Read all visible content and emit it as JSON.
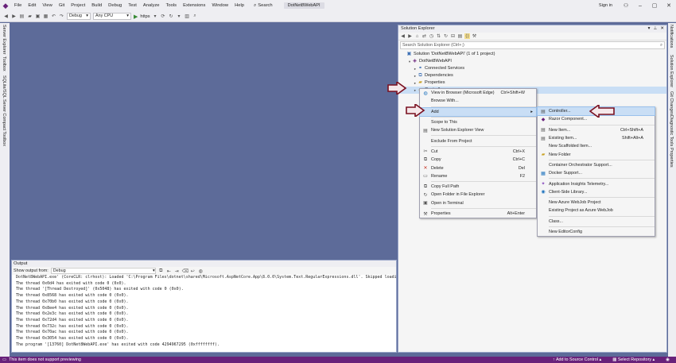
{
  "menubar": {
    "items": [
      "File",
      "Edit",
      "View",
      "Git",
      "Project",
      "Build",
      "Debug",
      "Test",
      "Analyze",
      "Tools",
      "Extensions",
      "Window",
      "Help"
    ],
    "search_label": "Search",
    "title_badge": "DotNet8WebAPI",
    "signin": "Sign in"
  },
  "toolbar": {
    "config": "Debug",
    "platform": "Any CPU",
    "run_label": "https"
  },
  "left_tabs": [
    "Server Explorer",
    "Toolbox",
    "SQLite/SQL Server Compact Toolbox"
  ],
  "right_tabs": [
    "Notifications",
    "Solution Explorer",
    "Git Changes",
    "Diagnostic Tools",
    "Properties"
  ],
  "solution_explorer": {
    "title": "Solution Explorer",
    "search_placeholder": "Search Solution Explorer (Ctrl+;)",
    "tree": [
      {
        "label": "Solution 'DotNet8WebAPI' (1 of 1 project)",
        "indent": 0,
        "icon": "solution-icon",
        "glyph": "▣"
      },
      {
        "label": "DotNet8WebAPI",
        "indent": 1,
        "icon": "project-icon",
        "glyph": "◈",
        "caret": "▾"
      },
      {
        "label": "Connected Services",
        "indent": 2,
        "icon": "connected-services-icon",
        "glyph": "⚭",
        "caret": "▸"
      },
      {
        "label": "Dependencies",
        "indent": 2,
        "icon": "dependencies-icon",
        "glyph": "⧉",
        "caret": "▸"
      },
      {
        "label": "Properties",
        "indent": 2,
        "icon": "properties-folder-icon",
        "glyph": "▰",
        "caret": "▸"
      },
      {
        "label": "Controllers",
        "indent": 2,
        "icon": "folder-icon",
        "glyph": "▰",
        "caret": "▸",
        "selected": true
      }
    ]
  },
  "context_menu": {
    "items": [
      {
        "label": "View in Browser (Microsoft Edge)",
        "shortcut": "Ctrl+Shift+W",
        "icon": "browser-icon",
        "glyph": "◍"
      },
      {
        "label": "Browse With...",
        "shortcut": "",
        "icon": "",
        "glyph": ""
      },
      {
        "sep": true
      },
      {
        "label": "Add",
        "shortcut": "",
        "submenu": true,
        "highlight": true,
        "icon": "",
        "glyph": ""
      },
      {
        "sep": true
      },
      {
        "label": "Scope to This",
        "shortcut": "",
        "icon": "",
        "glyph": ""
      },
      {
        "label": "New Solution Explorer View",
        "shortcut": "",
        "icon": "new-view-icon",
        "glyph": "▤"
      },
      {
        "sep": true
      },
      {
        "label": "Exclude From Project",
        "shortcut": "",
        "icon": "",
        "glyph": ""
      },
      {
        "sep": true
      },
      {
        "label": "Cut",
        "shortcut": "Ctrl+X",
        "icon": "cut-icon",
        "glyph": "✂"
      },
      {
        "label": "Copy",
        "shortcut": "Ctrl+C",
        "icon": "copy-icon",
        "glyph": "⧉"
      },
      {
        "label": "Delete",
        "shortcut": "Del",
        "icon": "delete-icon",
        "glyph": "✕"
      },
      {
        "label": "Rename",
        "shortcut": "F2",
        "icon": "rename-icon",
        "glyph": "▭"
      },
      {
        "sep": true
      },
      {
        "label": "Copy Full Path",
        "shortcut": "",
        "icon": "copy-path-icon",
        "glyph": "⧉"
      },
      {
        "label": "Open Folder in File Explorer",
        "shortcut": "",
        "icon": "open-folder-icon",
        "glyph": "↻"
      },
      {
        "label": "Open in Terminal",
        "shortcut": "",
        "icon": "terminal-icon",
        "glyph": "▣"
      },
      {
        "sep": true
      },
      {
        "label": "Properties",
        "shortcut": "Alt+Enter",
        "icon": "wrench-icon",
        "glyph": "⚒"
      }
    ]
  },
  "add_submenu": {
    "items": [
      {
        "label": "Controller...",
        "shortcut": "",
        "icon": "controller-icon",
        "glyph": "▤",
        "highlight": true
      },
      {
        "label": "Razor Component...",
        "shortcut": "",
        "icon": "razor-icon",
        "glyph": "◆"
      },
      {
        "sep": true
      },
      {
        "label": "New Item...",
        "shortcut": "Ctrl+Shift+A",
        "icon": "new-item-icon",
        "glyph": "▤"
      },
      {
        "label": "Existing Item...",
        "shortcut": "Shift+Alt+A",
        "icon": "existing-item-icon",
        "glyph": "▤"
      },
      {
        "label": "New Scaffolded Item...",
        "shortcut": "",
        "icon": "",
        "glyph": ""
      },
      {
        "label": "New Folder",
        "shortcut": "",
        "icon": "new-folder-icon",
        "glyph": "▰"
      },
      {
        "sep": true
      },
      {
        "label": "Container Orchestrator Support...",
        "shortcut": "",
        "icon": "",
        "glyph": ""
      },
      {
        "label": "Docker Support...",
        "shortcut": "",
        "icon": "docker-icon",
        "glyph": "▦"
      },
      {
        "sep": true
      },
      {
        "label": "Application Insights Telemetry...",
        "shortcut": "",
        "icon": "insights-icon",
        "glyph": "✦"
      },
      {
        "label": "Client-Side Library...",
        "shortcut": "",
        "icon": "library-icon",
        "glyph": "◉"
      },
      {
        "sep": true
      },
      {
        "label": "New Azure WebJob Project",
        "shortcut": "",
        "icon": "",
        "glyph": ""
      },
      {
        "label": "Existing Project as Azure WebJob",
        "shortcut": "",
        "icon": "",
        "glyph": ""
      },
      {
        "sep": true
      },
      {
        "label": "Class...",
        "shortcut": "",
        "icon": "",
        "glyph": ""
      },
      {
        "sep": true
      },
      {
        "label": "New EditorConfig",
        "shortcut": "",
        "icon": "",
        "glyph": ""
      }
    ]
  },
  "output": {
    "title": "Output",
    "show_from_label": "Show output from:",
    "show_from_value": "Debug",
    "lines": [
      "DotNet8WebAPI.exe' (CoreCLR: clrhost): Loaded 'C:\\Program Files\\dotnet\\shared\\Microsoft.AspNetCore.App\\8.0.0\\System.Text.RegularExpressions.dll'. Skipped loading sy",
      "The thread 0x0d4 has exited with code 0 (0x0).",
      "The thread '[Thread Destroyed]' (0x5048) has exited with code 0 (0x0).",
      "The thread 0x8568 has exited with code 0 (0x0).",
      "The thread 0x70b0 has exited with code 0 (0x0).",
      "The thread 0x8ee4 has exited with code 0 (0x0).",
      "The thread 0x2e3c has exited with code 0 (0x0).",
      "The thread 0x72d4 has exited with code 0 (0x0).",
      "The thread 0x732c has exited with code 0 (0x0).",
      "The thread 0x70ac has exited with code 0 (0x0).",
      "The thread 0x3054 has exited with code 0 (0x0).",
      "The program '[13760] DotNet8WebAPI.exe' has exited with code 4294967295 (0xffffffff)."
    ]
  },
  "status": {
    "message": "This item does not support previewing",
    "source_control": "Add to Source Control",
    "repository": "Select Repository"
  },
  "colors": {
    "accent": "#68217a",
    "background": "#5d6b99",
    "arrow": "#7a1020"
  }
}
